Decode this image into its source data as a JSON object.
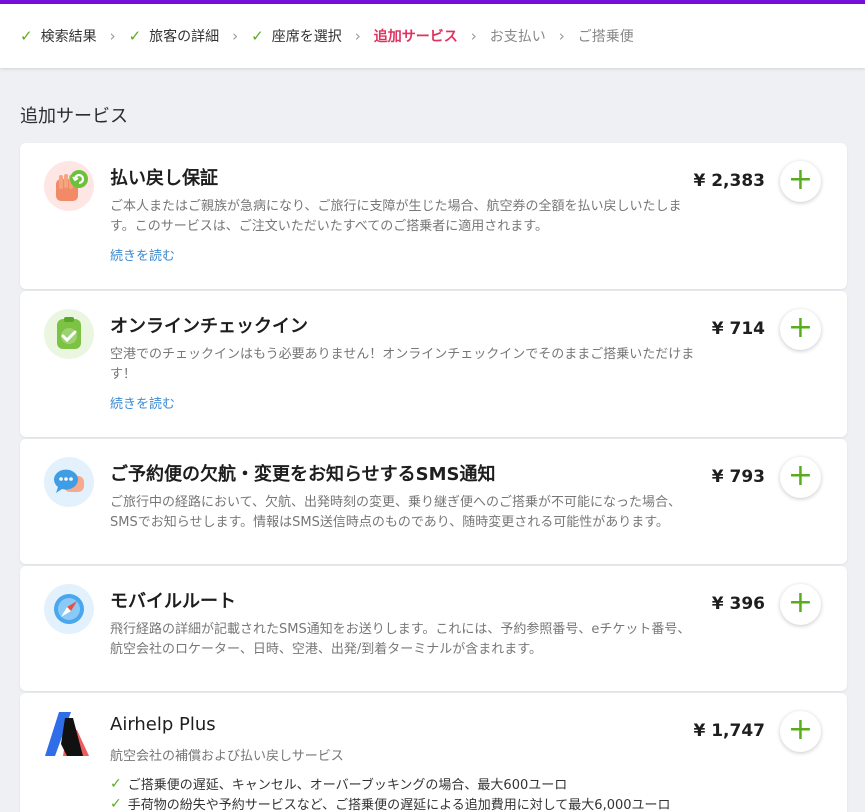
{
  "brand": {
    "accent": "#7410d9",
    "active": "#e0325e",
    "success": "#5aac1e",
    "link": "#3c8ad1"
  },
  "steps": [
    {
      "label": "検索結果",
      "state": "done"
    },
    {
      "label": "旅客の詳細",
      "state": "done"
    },
    {
      "label": "座席を選択",
      "state": "done"
    },
    {
      "label": "追加サービス",
      "state": "active"
    },
    {
      "label": "お支払い",
      "state": "todo"
    },
    {
      "label": "ご搭乗便",
      "state": "todo"
    }
  ],
  "section_title": "追加サービス",
  "services": [
    {
      "icon": "refund-hand-icon",
      "title": "払い戻し保証",
      "description": "ご本人またはご親族が急病になり、ご旅行に支障が生じた場合、航空券の全額を払い戻しいたします。このサービスは、ご注文いただいたすべてのご搭乗者に適用されます。",
      "read_more": "続きを読む",
      "price": "¥ 2,383"
    },
    {
      "icon": "online-checkin-icon",
      "title": "オンラインチェックイン",
      "description": "空港でのチェックインはもう必要ありません！オンラインチェックインでそのままご搭乗いただけます！",
      "read_more": "続きを読む",
      "price": "¥ 714"
    },
    {
      "icon": "sms-chat-icon",
      "title": "ご予約便の欠航・変更をお知らせするSMS通知",
      "description": "ご旅行中の経路において、欠航、出発時刻の変更、乗り継ぎ便へのご搭乗が不可能になった場合、SMSでお知らせします。情報はSMS送信時点のものであり、随時変更される可能性があります。",
      "price": "¥ 793"
    },
    {
      "icon": "compass-icon",
      "title": "モバイルルート",
      "description": "飛行経路の詳細が記載されたSMS通知をお送りします。これには、予約参照番号、eチケット番号、航空会社のロケーター、日時、空港、出発/到着ターミナルが含まれます。",
      "price": "¥ 396"
    },
    {
      "icon": "airhelp-logo-icon",
      "title": "Airhelp Plus",
      "description": "航空会社の補償および払い戻しサービス",
      "price": "¥ 1,747",
      "features": [
        "ご搭乗便の遅延、キャンセル、オーバーブッキングの場合、最大600ユーロ",
        "手荷物の紛失や予約サービスなど、ご搭乗便の遅延による追加費用に対して最大6,000ユーロ"
      ]
    }
  ]
}
